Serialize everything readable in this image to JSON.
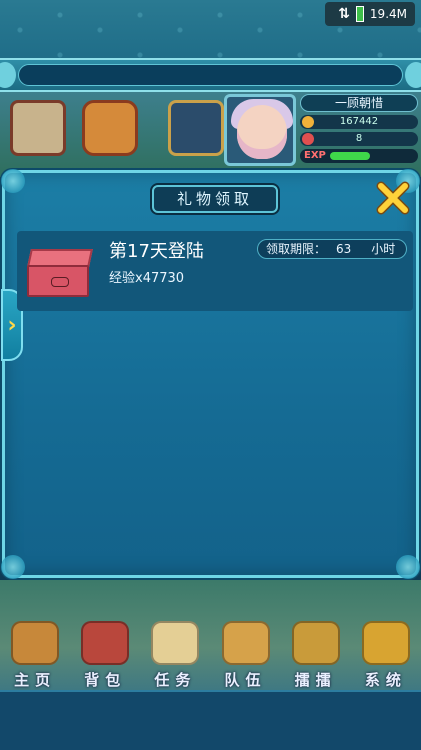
{
  "status_bar": {
    "data_rate": "19.4M",
    "network_icon": "data-transfer-arrows-icon",
    "battery_icon": "battery-icon"
  },
  "player": {
    "name": "一顾朝惜",
    "stat_1": "167442",
    "stat_2": "8",
    "exp_label": "EXP",
    "exp_fraction": 0.5
  },
  "dialog": {
    "title": "礼物领取",
    "close_icon": "close-x-icon",
    "side_arrow_icon": "chevron-right-icon",
    "gifts": [
      {
        "title": "第17天登陆",
        "reward": "经验x47730",
        "deadline_label": "领取期限：",
        "deadline_value": "63",
        "deadline_unit": "小时",
        "icon": "red-gift-box-icon"
      }
    ]
  },
  "nav": [
    {
      "label": "主页",
      "icon": "home-pagoda-icon",
      "color": "#c7883a"
    },
    {
      "label": "背包",
      "icon": "backpack-chest-icon",
      "color": "#b9473c"
    },
    {
      "label": "任务",
      "icon": "scroll-icon",
      "color": "#e4cf95"
    },
    {
      "label": "队伍",
      "icon": "team-figure-icon",
      "color": "#d6a24a"
    },
    {
      "label": "擂擂",
      "icon": "sword-icon",
      "color": "#c99b3a"
    },
    {
      "label": "系统",
      "icon": "gear-icon",
      "color": "#d8a431"
    }
  ]
}
